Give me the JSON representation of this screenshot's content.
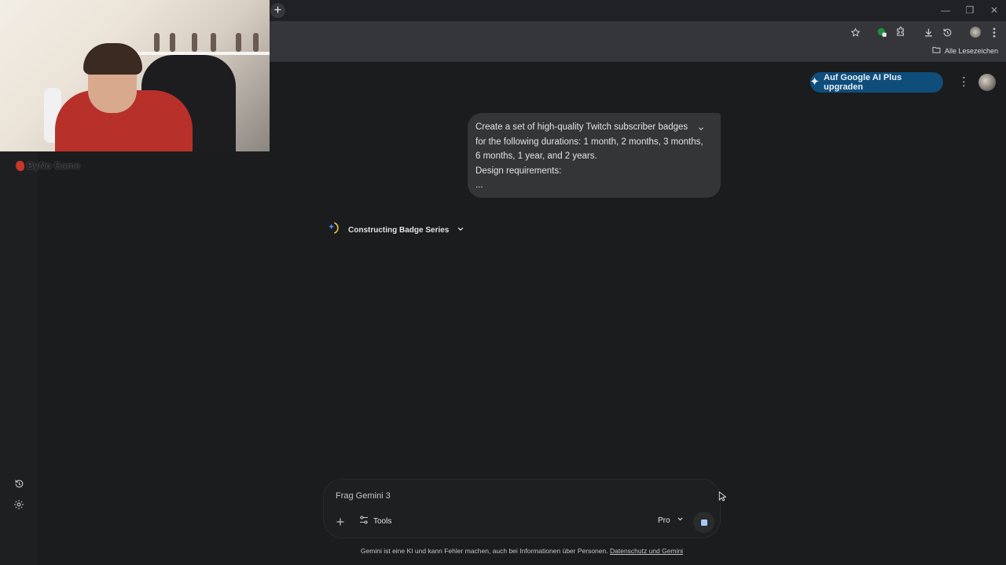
{
  "browser": {
    "new_tab_symbol": "+",
    "window_controls": {
      "minimize": "—",
      "restore": "❐",
      "close": "✕"
    },
    "bookmarks_bar": {
      "all_bookmarks": "Alle Lesezeichen"
    }
  },
  "overlay": {
    "logo_text": "ByNo Game"
  },
  "header": {
    "upgrade_button": "Auf Google AI Plus upgraden",
    "menu_symbol": "⋮"
  },
  "conversation": {
    "prompt_lines": [
      "Create a set of high-quality Twitch subscriber badges",
      "for the following durations: 1 month, 2 months, 3 months,",
      "6 months, 1 year, and 2 years.",
      "Design requirements:",
      "..."
    ],
    "thinking_label": "Constructing Badge Series"
  },
  "composer": {
    "placeholder": "Frag Gemini 3",
    "tools_label": "Tools",
    "model_label": "Pro"
  },
  "footer": {
    "disclaimer": "Gemini ist eine KI und kann Fehler machen, auch bei Informationen über Personen.",
    "privacy_link": "Datenschutz und Gemini"
  },
  "colors": {
    "background": "#1b1c1d",
    "sidebar": "#1e1f20",
    "bubble": "#333537",
    "upgrade_button": "#0f4d7a",
    "stop_button_accent": "#a8c7fa"
  }
}
